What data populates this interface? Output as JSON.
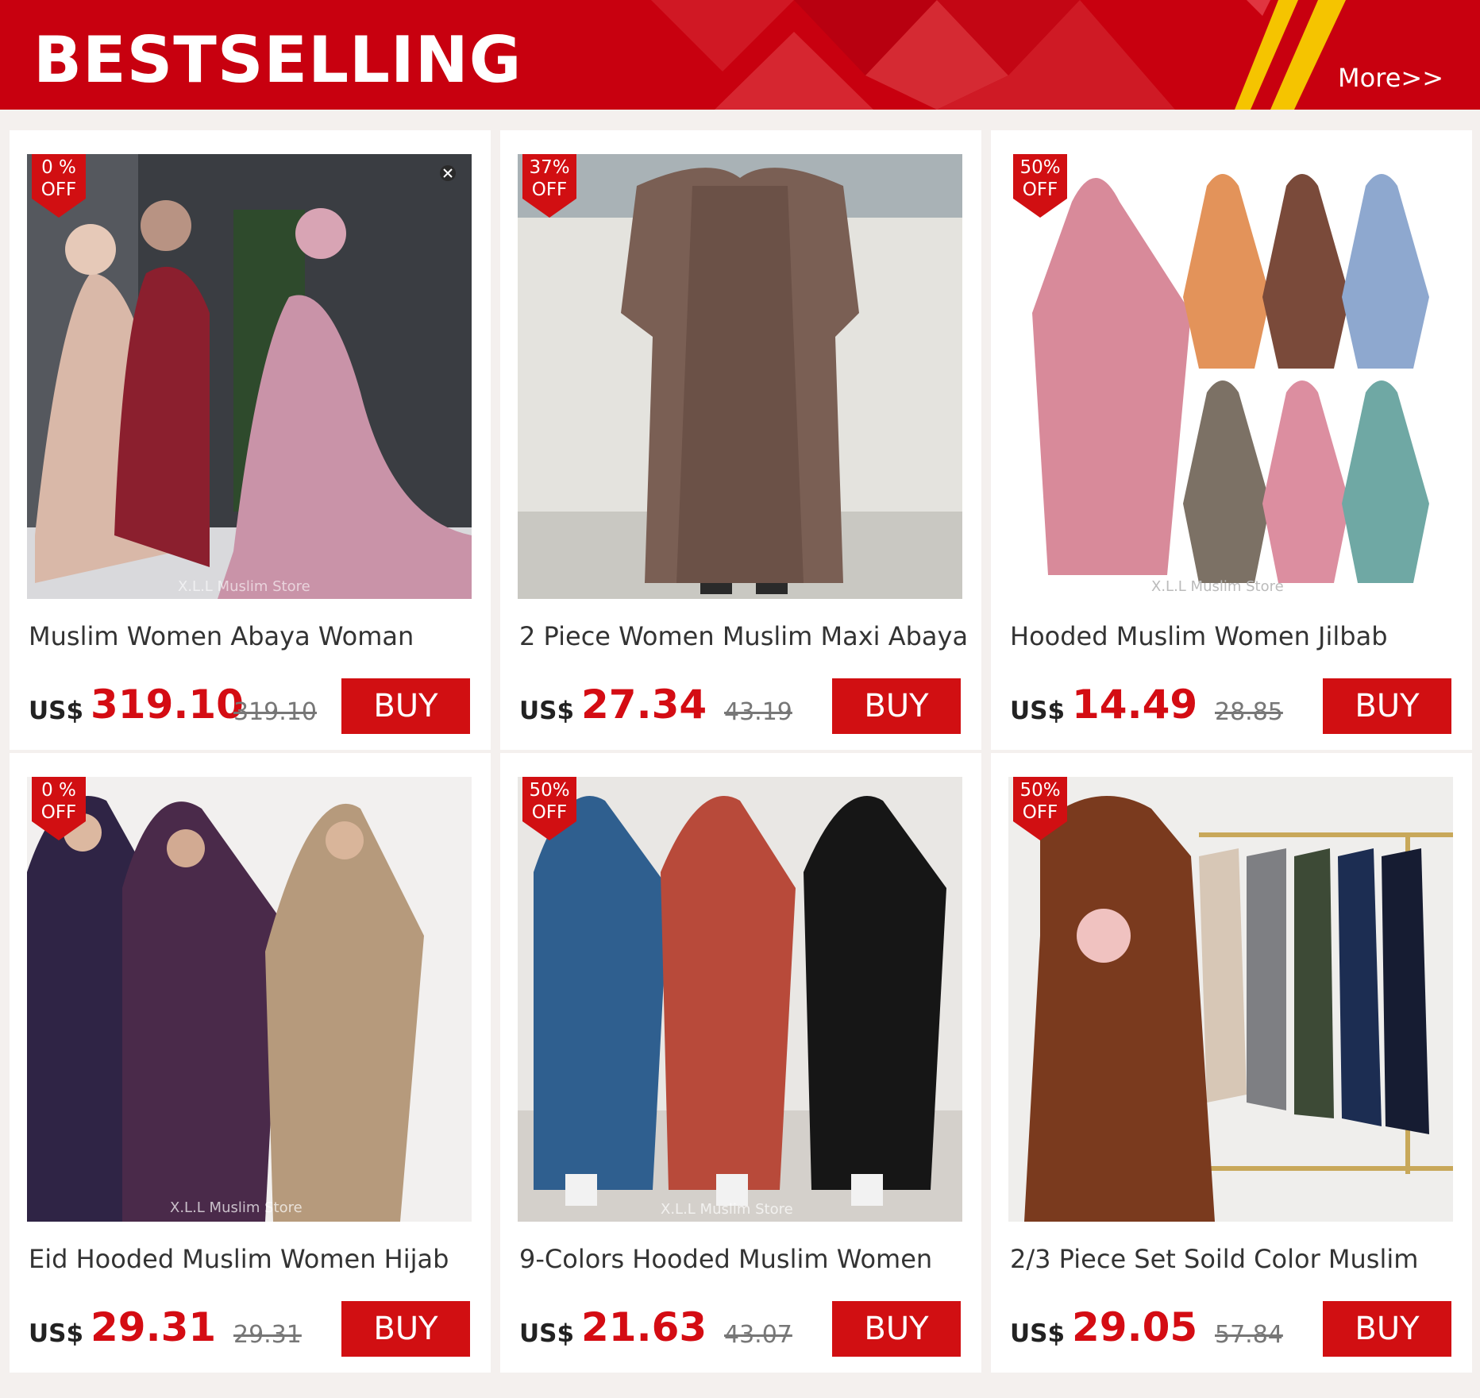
{
  "header": {
    "title": "BESTSELLING",
    "more_label": "More>>"
  },
  "colors": {
    "banner_red": "#c8000f",
    "accent_gold": "#f5c400",
    "price_red": "#d40c13",
    "buy_red": "#d10f12"
  },
  "products": [
    {
      "discount": "0 %",
      "off": "OFF",
      "title": "Muslim Women Abaya Woman",
      "currency": "US$",
      "price": "319.10",
      "original_price": "319.10",
      "buy_label": "BUY",
      "watermark": "X.L.L Muslim Store"
    },
    {
      "discount": "37%",
      "off": "OFF",
      "title": "2 Piece Women Muslim Maxi Abaya",
      "currency": "US$",
      "price": "27.34",
      "original_price": "43.19",
      "buy_label": "BUY",
      "watermark": ""
    },
    {
      "discount": "50%",
      "off": "OFF",
      "title": "Hooded Muslim Women Jilbab",
      "currency": "US$",
      "price": "14.49",
      "original_price": "28.85",
      "buy_label": "BUY",
      "watermark": "X.L.L Muslim Store"
    },
    {
      "discount": "0 %",
      "off": "OFF",
      "title": "Eid Hooded Muslim Women Hijab",
      "currency": "US$",
      "price": "29.31",
      "original_price": "29.31",
      "buy_label": "BUY",
      "watermark": "X.L.L Muslim Store"
    },
    {
      "discount": "50%",
      "off": "OFF",
      "title": "9-Colors Hooded Muslim Women",
      "currency": "US$",
      "price": "21.63",
      "original_price": "43.07",
      "buy_label": "BUY",
      "watermark": "X.L.L Muslim Store"
    },
    {
      "discount": "50%",
      "off": "OFF",
      "title": "2/3 Piece Set Soild Color Muslim",
      "currency": "US$",
      "price": "29.05",
      "original_price": "57.84",
      "buy_label": "BUY",
      "watermark": ""
    }
  ]
}
